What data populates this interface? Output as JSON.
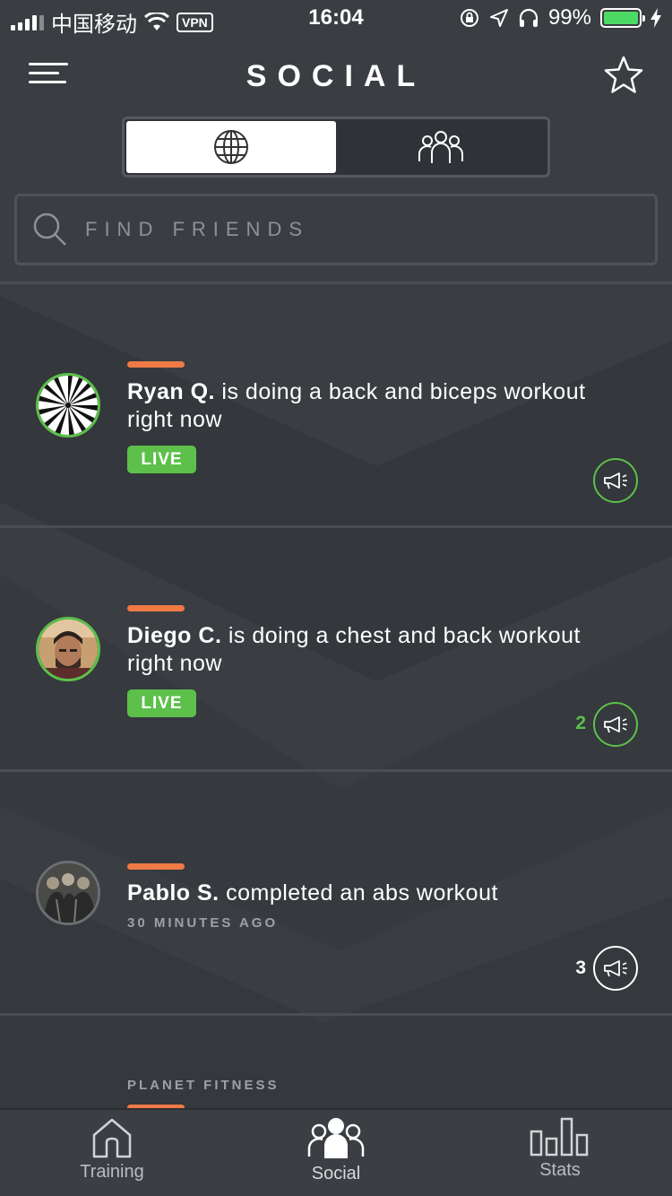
{
  "status_bar": {
    "carrier": "中国移动",
    "vpn": "VPN",
    "time": "16:04",
    "battery": "99%"
  },
  "header": {
    "title": "SOCIAL",
    "menu_icon": "hamburger-menu-icon",
    "star_icon": "star-icon"
  },
  "segmented": {
    "options": [
      {
        "icon": "globe-icon",
        "active": true
      },
      {
        "icon": "group-icon",
        "active": false
      }
    ]
  },
  "search": {
    "placeholder": "FIND FRIENDS"
  },
  "feed": [
    {
      "name": "Ryan Q.",
      "action": " is doing a back and biceps workout right now",
      "badge": "LIVE",
      "hype_count": ""
    },
    {
      "name": "Diego C.",
      "action": " is doing a chest and back workout right now",
      "badge": "LIVE",
      "hype_count": "2"
    },
    {
      "name": "Pablo S.",
      "action": " completed an abs workout",
      "time_ago": "30 MINUTES AGO",
      "hype_count": "3"
    }
  ],
  "section_label": "PLANET FITNESS",
  "tabbar": {
    "tabs": [
      {
        "label": "Training",
        "icon": "home-icon"
      },
      {
        "label": "Social",
        "icon": "social-group-icon",
        "active": true
      },
      {
        "label": "Stats",
        "icon": "bar-chart-icon"
      }
    ]
  },
  "colors": {
    "background": "#3a3d41",
    "accent_green": "#5cc04b",
    "accent_orange": "#ef7a45"
  }
}
